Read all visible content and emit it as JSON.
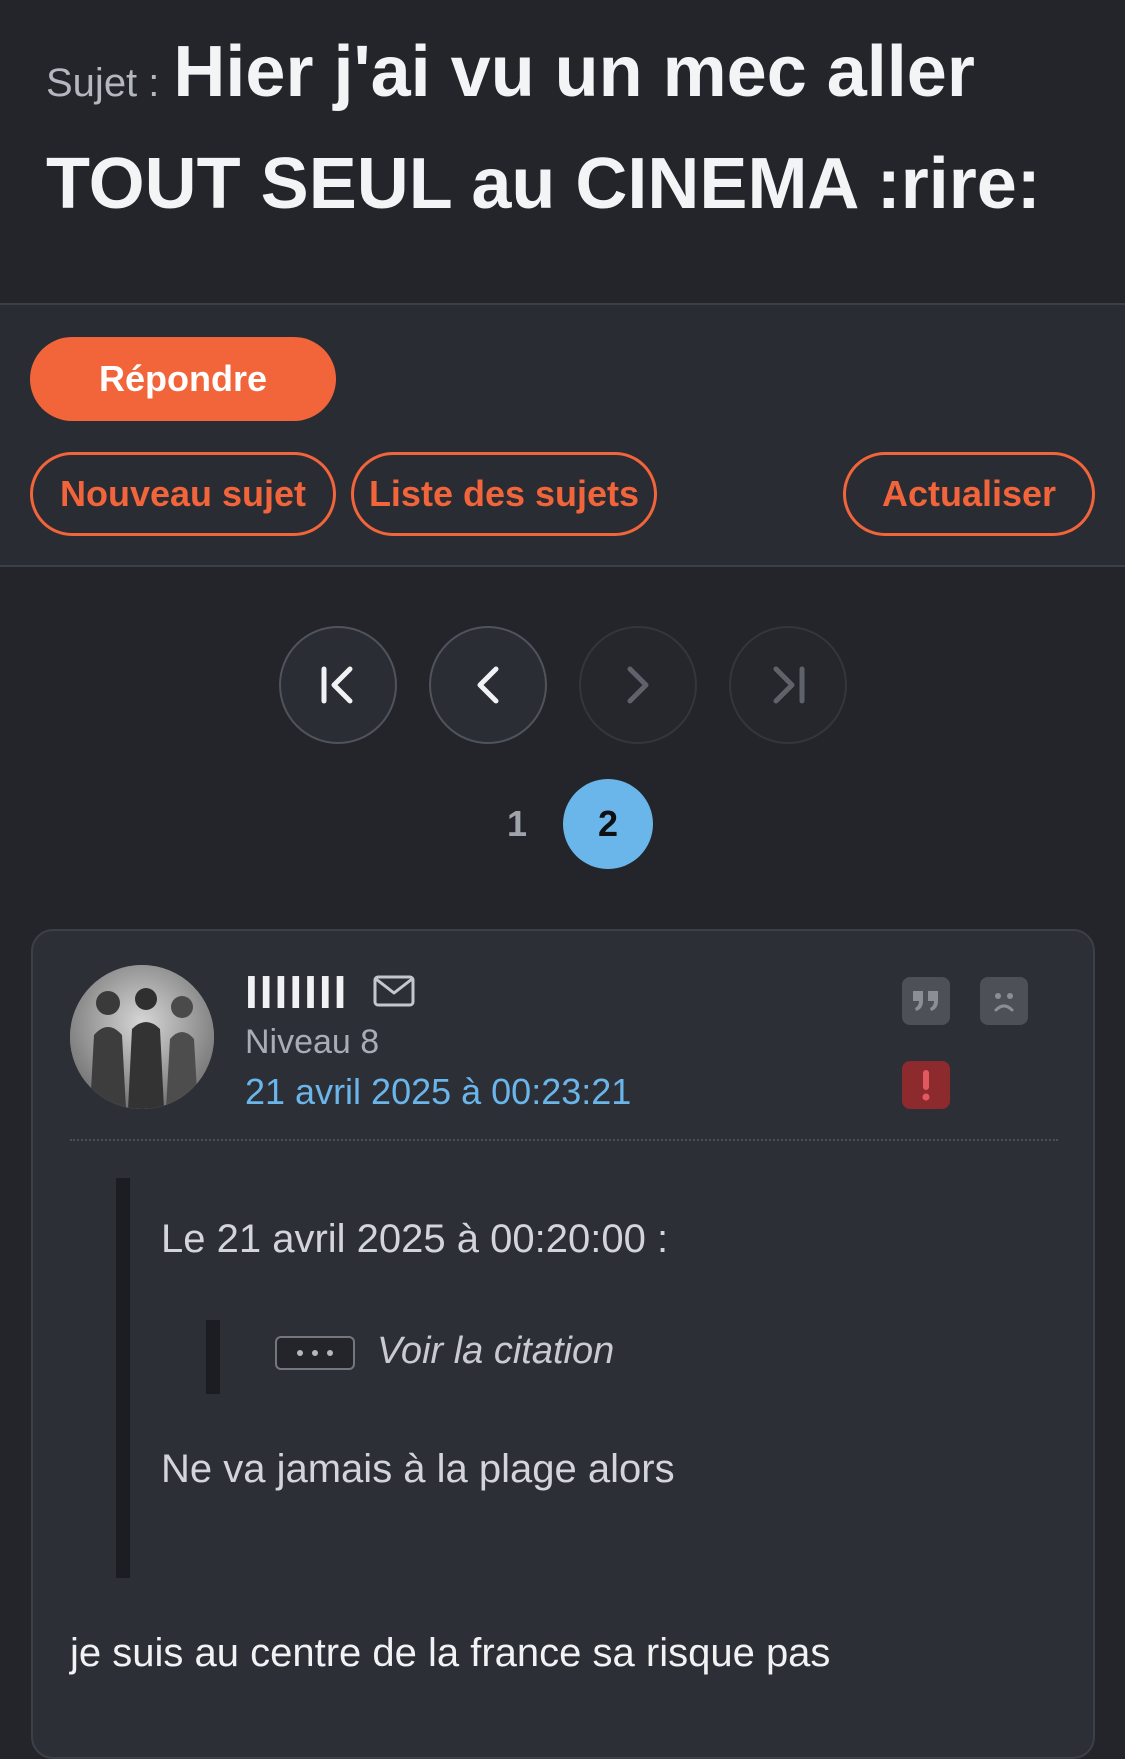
{
  "topic": {
    "prefix": "Sujet :",
    "title": "Hier j'ai vu un mec aller TOUT SEUL au CINEMA :rire:"
  },
  "actions": {
    "reply_label": "Répondre",
    "new_topic_label": "Nouveau sujet",
    "topic_list_label": "Liste des sujets",
    "refresh_label": "Actualiser",
    "accent_color": "#f2643a"
  },
  "pagination": {
    "pages": [
      "1",
      "2"
    ],
    "current_page": "2",
    "first_enabled": true,
    "prev_enabled": true,
    "next_enabled": false,
    "last_enabled": false
  },
  "post": {
    "username": "IIIIIII",
    "level": "Niveau 8",
    "date": "21 avril 2025 à 00:23:21",
    "quote": {
      "header": "Le 21 avril 2025 à 00:20:00 :",
      "see_quote_label": "Voir la citation",
      "body": "Ne va jamais à la plage alors"
    },
    "body": "je suis au centre de la france sa risque pas",
    "icons": [
      "mail-icon",
      "quote-icon",
      "kick-icon",
      "alert-icon"
    ]
  }
}
